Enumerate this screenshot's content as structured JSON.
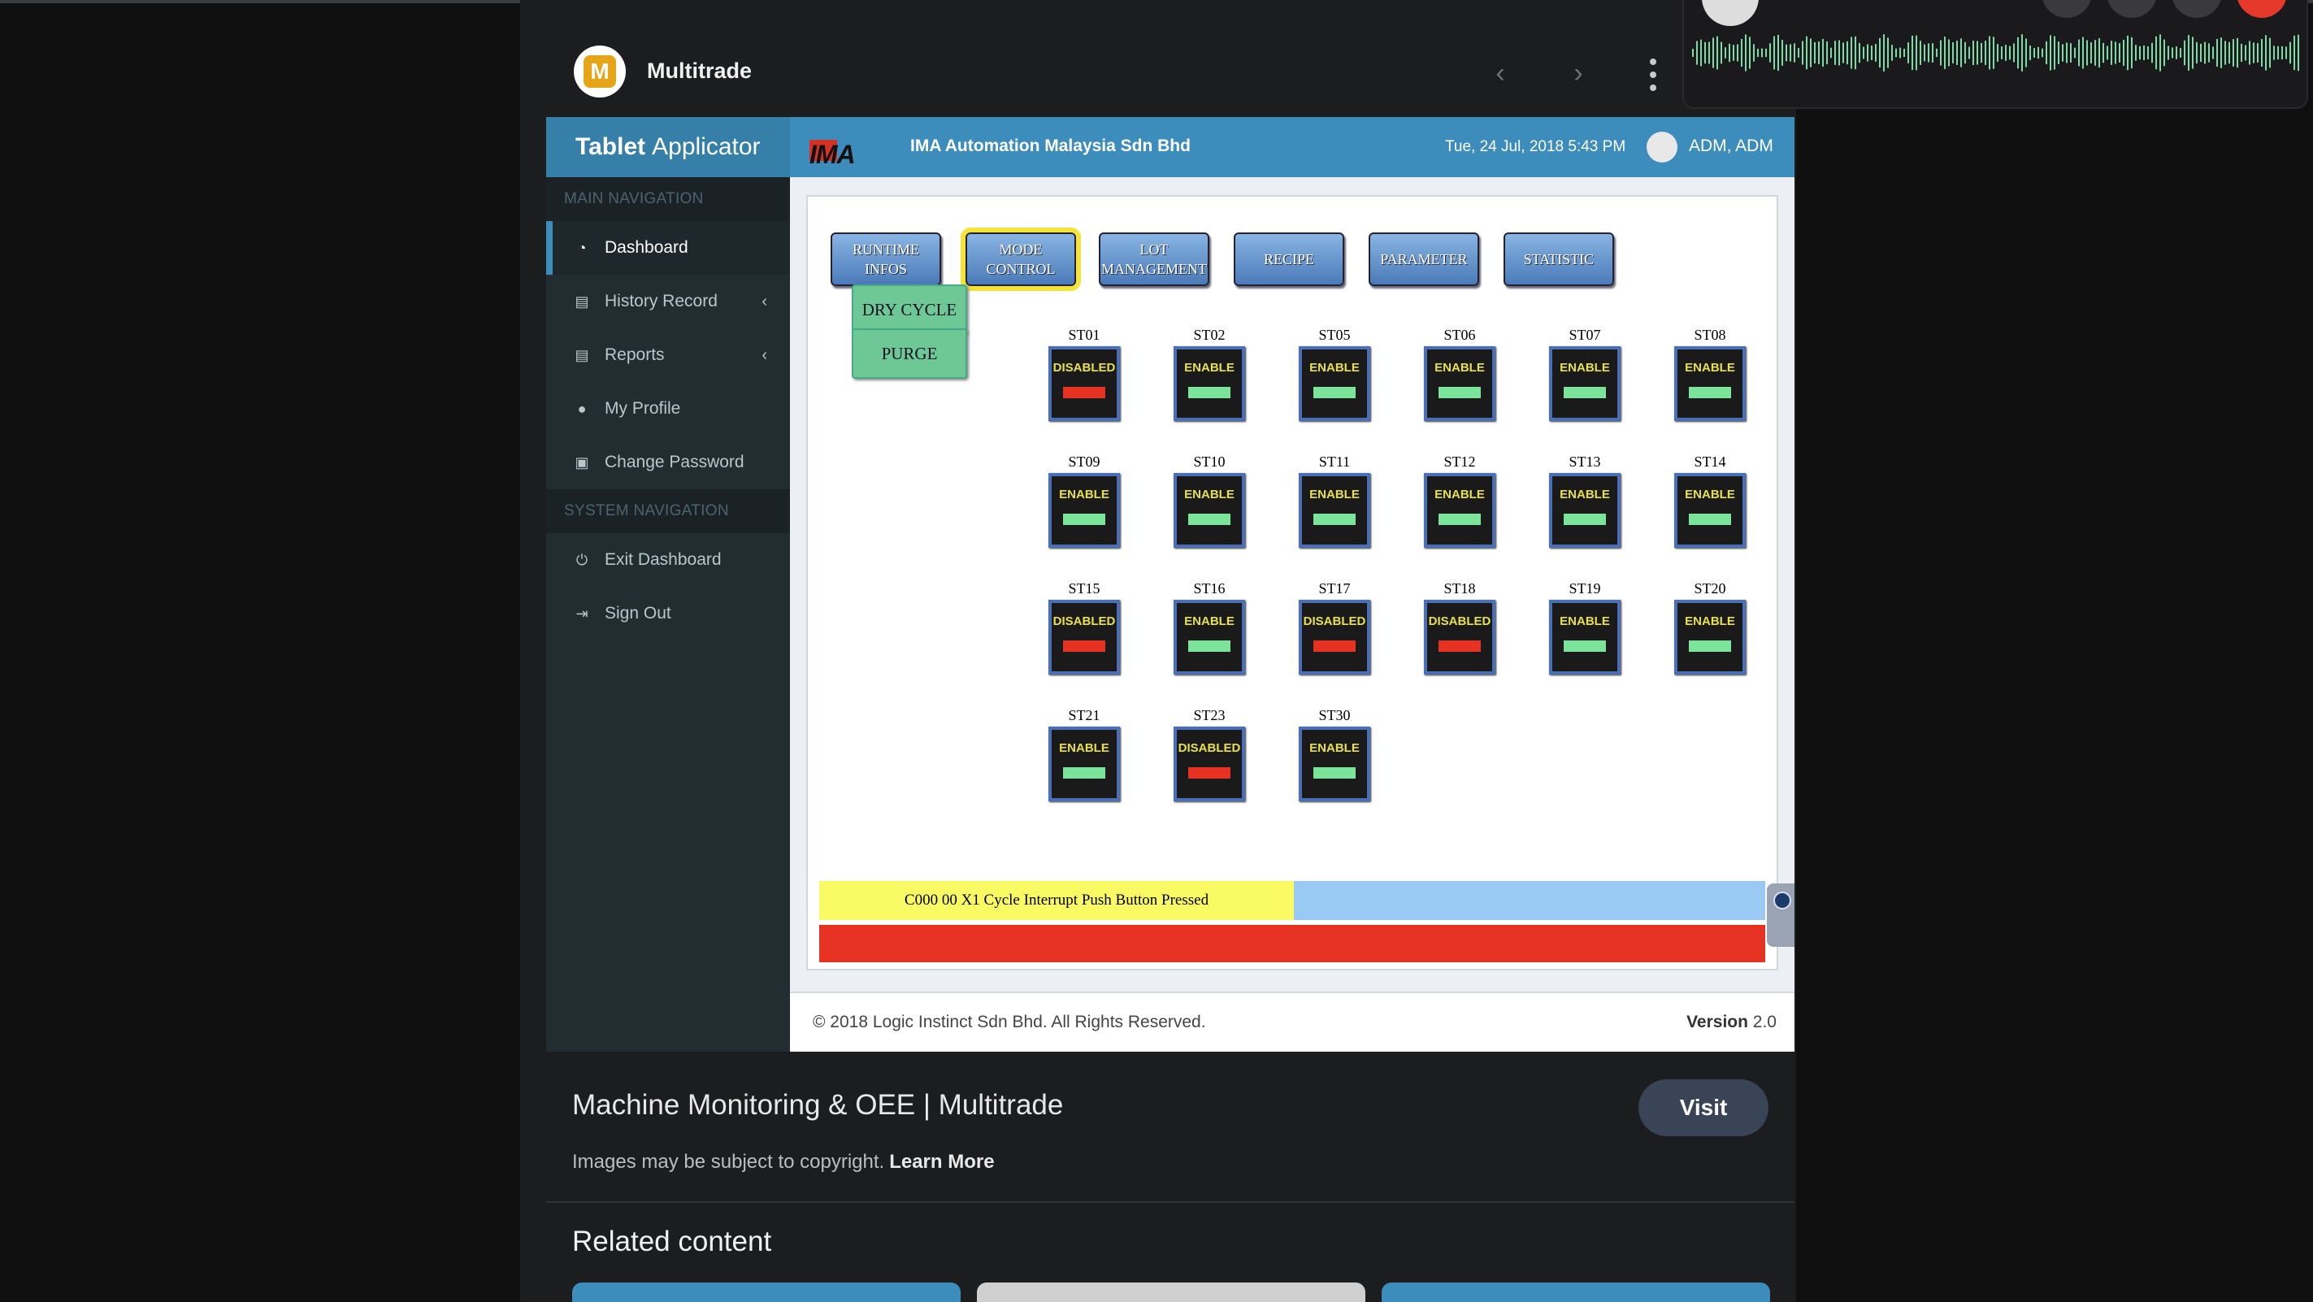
{
  "viewer": {
    "site_name": "Multitrade",
    "logo_letter": "M",
    "prev_icon": "chevron-left-icon",
    "next_icon": "chevron-right-icon",
    "more_icon": "more-vert-icon"
  },
  "app": {
    "brand_bold": "Tablet",
    "brand_rest": "Applicator",
    "company_logo": "IMA",
    "company_name": "IMA Automation Malaysia Sdn Bhd",
    "datetime": "Tue, 24 Jul, 2018 5:43 PM",
    "user": "ADM, ADM",
    "sidebar": {
      "main_section": "MAIN NAVIGATION",
      "system_section": "SYSTEM NAVIGATION",
      "main_items": [
        {
          "label": "Dashboard",
          "icon": "dashboard-icon",
          "caret": ""
        },
        {
          "label": "History Record",
          "icon": "file-icon",
          "caret": "‹"
        },
        {
          "label": "Reports",
          "icon": "file-icon",
          "caret": "‹"
        },
        {
          "label": "My Profile",
          "icon": "user-icon",
          "caret": ""
        },
        {
          "label": "Change Password",
          "icon": "lock-icon",
          "caret": ""
        }
      ],
      "system_items": [
        {
          "label": "Exit Dashboard",
          "icon": "power-icon"
        },
        {
          "label": "Sign Out",
          "icon": "sign-out-icon"
        }
      ]
    },
    "hmi": {
      "tabs": [
        {
          "label": "RUNTIME\nINFOS",
          "selected": false
        },
        {
          "label": "MODE\nCONTROL",
          "selected": true
        },
        {
          "label": "LOT\nMANAGEMENT",
          "selected": false
        },
        {
          "label": "RECIPE",
          "selected": false
        },
        {
          "label": "PARAMETER",
          "selected": false
        },
        {
          "label": "STATISTIC",
          "selected": false
        }
      ],
      "actions": {
        "dry_cycle": "DRY CYCLE",
        "purge": "PURGE"
      },
      "stations": [
        {
          "name": "ST01",
          "status": "DISABLED"
        },
        {
          "name": "ST02",
          "status": "ENABLE"
        },
        {
          "name": "ST05",
          "status": "ENABLE"
        },
        {
          "name": "ST06",
          "status": "ENABLE"
        },
        {
          "name": "ST07",
          "status": "ENABLE"
        },
        {
          "name": "ST08",
          "status": "ENABLE"
        },
        {
          "name": "ST09",
          "status": "ENABLE"
        },
        {
          "name": "ST10",
          "status": "ENABLE"
        },
        {
          "name": "ST11",
          "status": "ENABLE"
        },
        {
          "name": "ST12",
          "status": "ENABLE"
        },
        {
          "name": "ST13",
          "status": "ENABLE"
        },
        {
          "name": "ST14",
          "status": "ENABLE"
        },
        {
          "name": "ST15",
          "status": "DISABLED"
        },
        {
          "name": "ST16",
          "status": "ENABLE"
        },
        {
          "name": "ST17",
          "status": "DISABLED"
        },
        {
          "name": "ST18",
          "status": "DISABLED"
        },
        {
          "name": "ST19",
          "status": "ENABLE"
        },
        {
          "name": "ST20",
          "status": "ENABLE"
        },
        {
          "name": "ST21",
          "status": "ENABLE"
        },
        {
          "name": "ST23",
          "status": "DISABLED"
        },
        {
          "name": "ST30",
          "status": "ENABLE"
        }
      ],
      "alarm_message": "C000 00 X1 Cycle Interrupt Push Button Pressed"
    },
    "footer": {
      "copyright": "© 2018 Logic Instinct Sdn Bhd. All Rights Reserved.",
      "version_label": "Version",
      "version_number": "2.0"
    }
  },
  "details": {
    "title": "Machine Monitoring & OEE | Multitrade",
    "visit_label": "Visit",
    "copyright_note": "Images may be subject to copyright.",
    "learn_more": "Learn More",
    "related_title": "Related content"
  },
  "colors": {
    "enable_bar": "#7be39a",
    "disabled_bar": "#e53223",
    "accent": "#3c8dbc"
  }
}
